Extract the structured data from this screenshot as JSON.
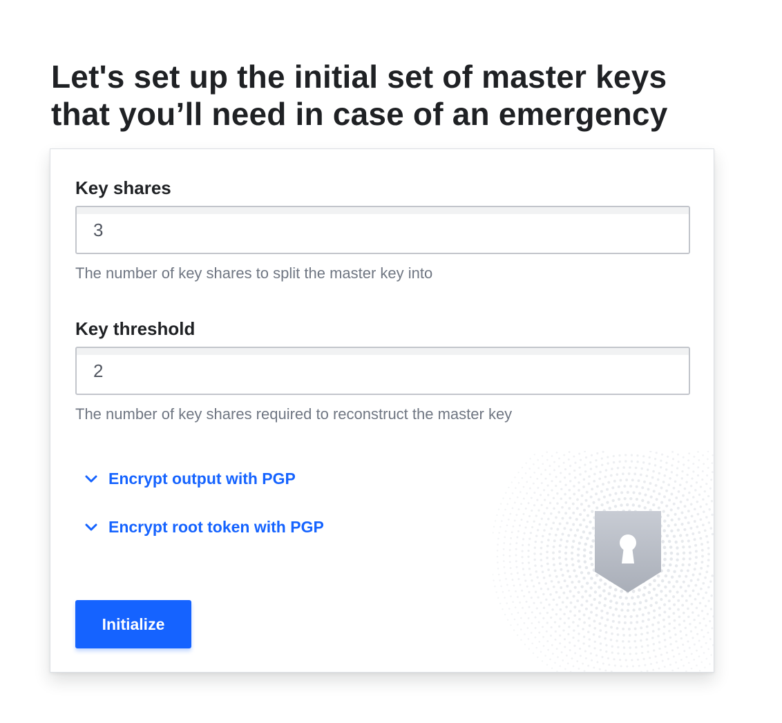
{
  "page": {
    "title": "Let's set up the initial set of master keys that you’ll need in case of an emergency"
  },
  "form": {
    "key_shares": {
      "label": "Key shares",
      "value": "3",
      "help": "The number of key shares to split the master key into"
    },
    "key_threshold": {
      "label": "Key threshold",
      "value": "2",
      "help": "The number of key shares required to reconstruct the master key"
    },
    "toggles": [
      {
        "label": "Encrypt output with PGP",
        "icon": "chevron-down-icon"
      },
      {
        "label": "Encrypt root token with PGP",
        "icon": "chevron-down-icon"
      }
    ],
    "submit_label": "Initialize"
  },
  "decoration": {
    "icon": "keyhole-shield-icon"
  },
  "colors": {
    "accent": "#1563ff",
    "text": "#1f2124",
    "help_text": "#6f7682",
    "shield": "#b5bac4"
  }
}
